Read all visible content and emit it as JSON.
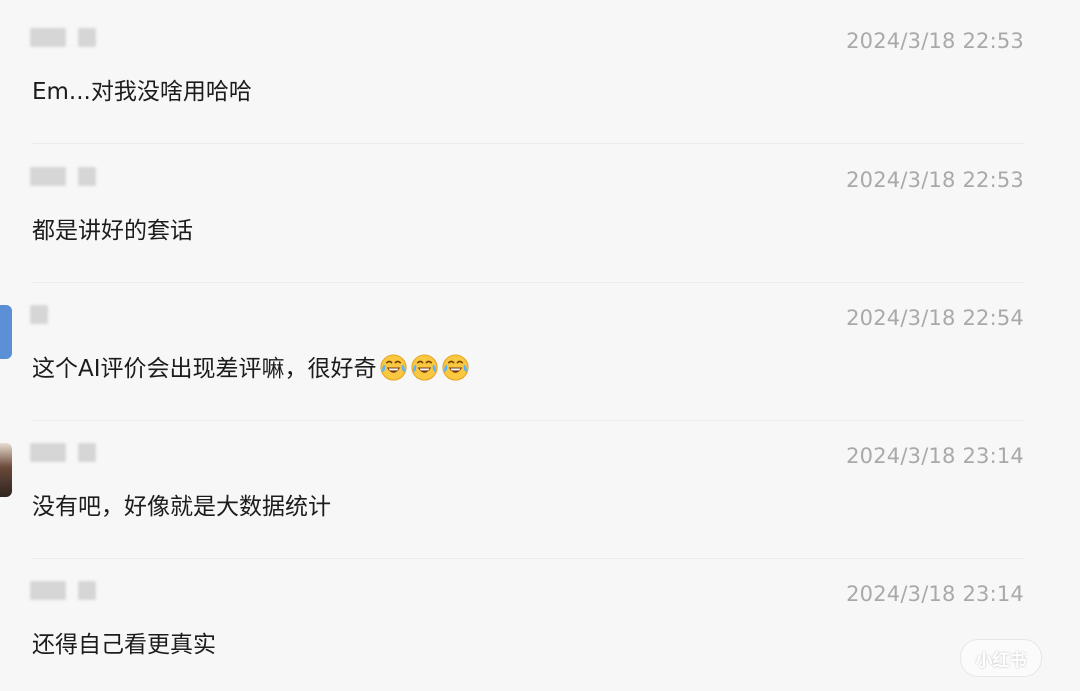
{
  "comments": [
    {
      "timestamp": "2024/3/18 22:53",
      "text": "Em...对我没啥用哈哈"
    },
    {
      "timestamp": "2024/3/18 22:53",
      "text": "都是讲好的套话"
    },
    {
      "timestamp": "2024/3/18 22:54",
      "text": "这个AI评价会出现差评嘛，很好奇",
      "emoji": [
        "tears-of-joy",
        "tears-of-joy",
        "tears-of-joy"
      ]
    },
    {
      "timestamp": "2024/3/18 23:14",
      "text": "没有吧，好像就是大数据统计"
    },
    {
      "timestamp": "2024/3/18 23:14",
      "text": "还得自己看更真实"
    }
  ],
  "watermark": "小红书",
  "colors": {
    "background": "#f7f7f7",
    "text": "#1c1c1c",
    "timestamp": "#a9a9a9",
    "redacted": "#d6d6d6",
    "avatar_blue": "#5b8fd6"
  }
}
